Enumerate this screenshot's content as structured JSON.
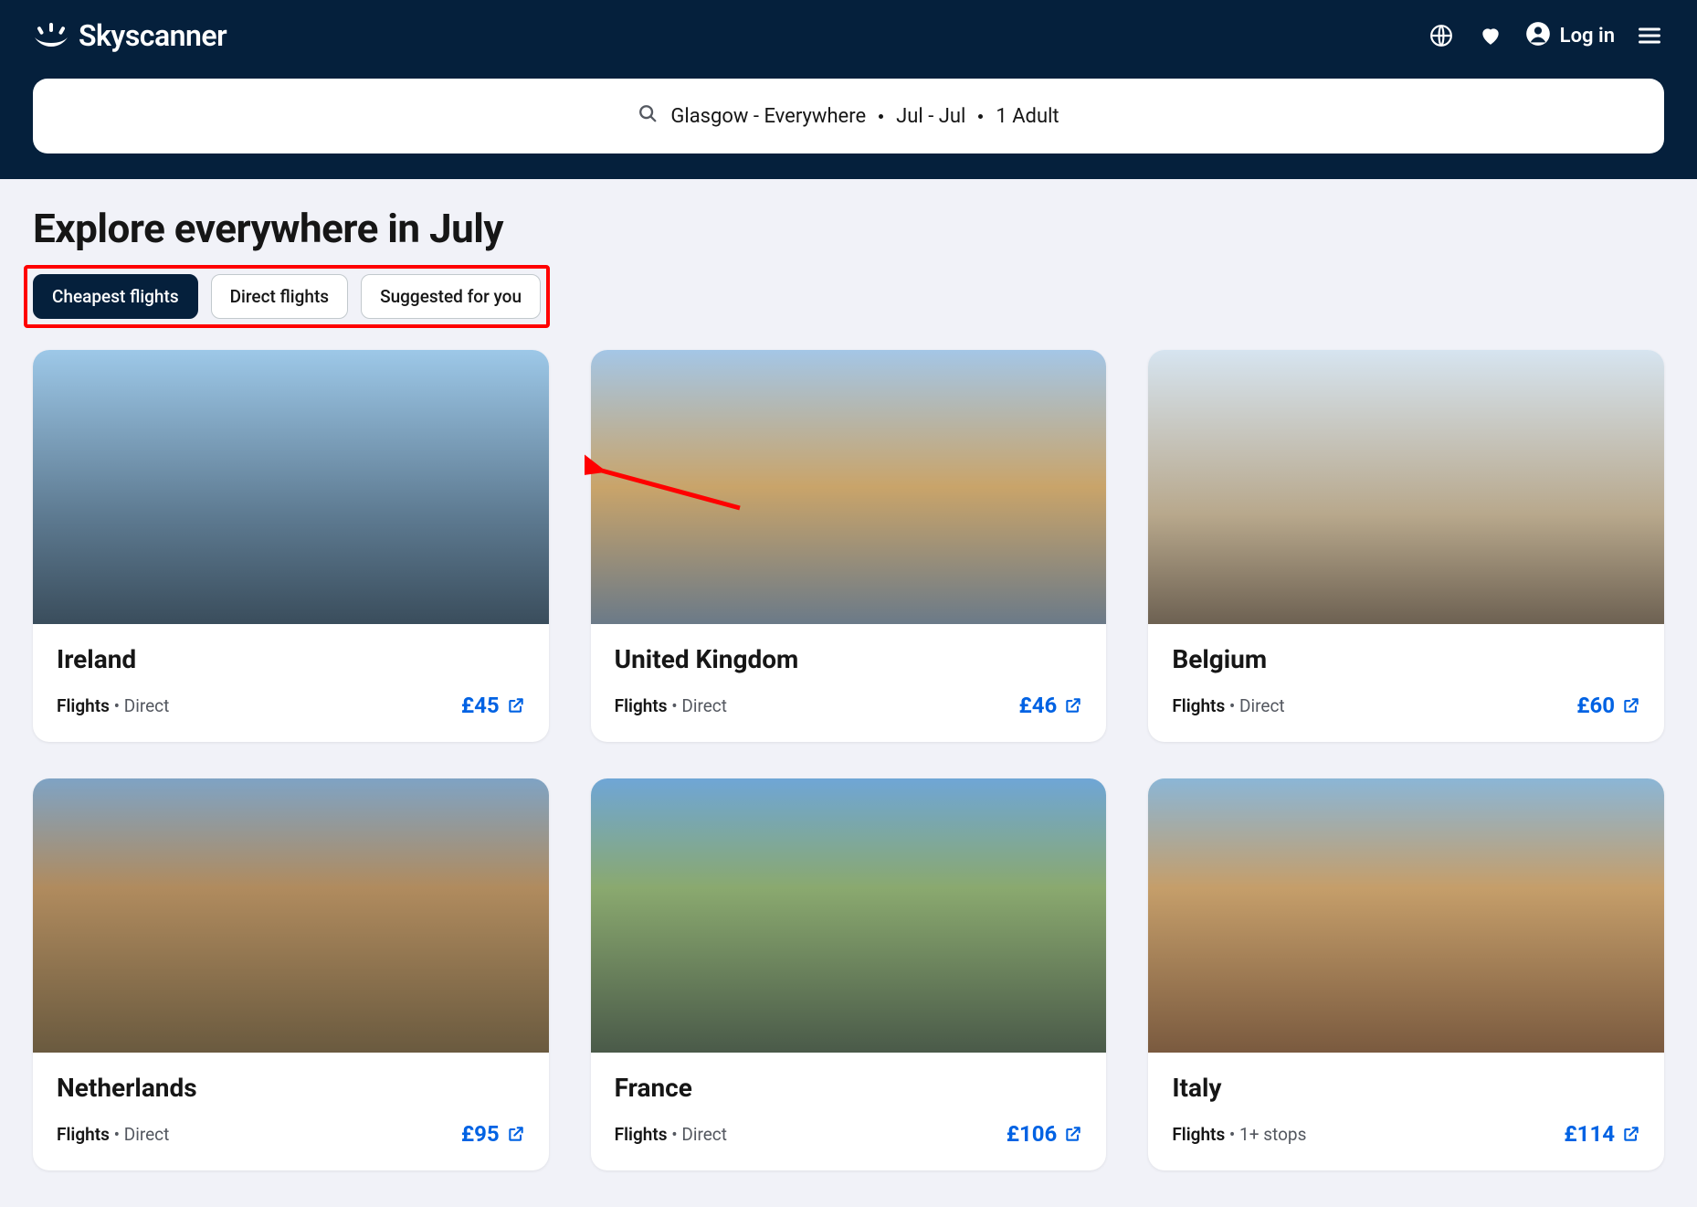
{
  "header": {
    "brand": "Skyscanner",
    "login_label": "Log in"
  },
  "search": {
    "route": "Glasgow - Everywhere",
    "dates": "Jul - Jul",
    "travellers": "1 Adult"
  },
  "page_title": "Explore everywhere in July",
  "filters": [
    {
      "label": "Cheapest flights",
      "active": true
    },
    {
      "label": "Direct flights",
      "active": false
    },
    {
      "label": "Suggested for you",
      "active": false
    }
  ],
  "cards": [
    {
      "name": "Ireland",
      "flights_label": "Flights",
      "meta": "Direct",
      "price": "£45",
      "img_class": "img-ireland"
    },
    {
      "name": "United Kingdom",
      "flights_label": "Flights",
      "meta": "Direct",
      "price": "£46",
      "img_class": "img-uk"
    },
    {
      "name": "Belgium",
      "flights_label": "Flights",
      "meta": "Direct",
      "price": "£60",
      "img_class": "img-belgium"
    },
    {
      "name": "Netherlands",
      "flights_label": "Flights",
      "meta": "Direct",
      "price": "£95",
      "img_class": "img-netherlands"
    },
    {
      "name": "France",
      "flights_label": "Flights",
      "meta": "Direct",
      "price": "£106",
      "img_class": "img-france"
    },
    {
      "name": "Italy",
      "flights_label": "Flights",
      "meta": "1+ stops",
      "price": "£114",
      "img_class": "img-italy"
    }
  ]
}
